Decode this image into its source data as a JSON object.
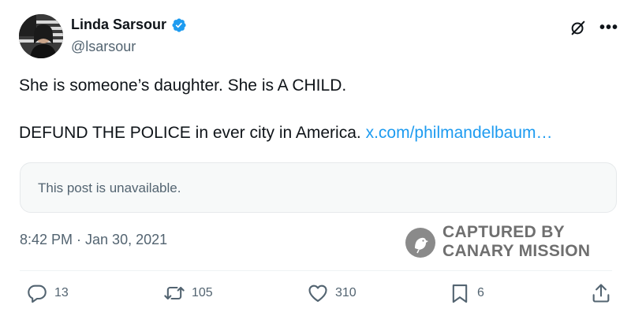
{
  "author": {
    "display_name": "Linda Sarsour",
    "handle": "@lsarsour",
    "verified": true,
    "avatar_icon": "profile-photo"
  },
  "header_actions": {
    "grok_icon": "grok-icon",
    "more_label": "•••"
  },
  "tweet": {
    "line1": "She is someone’s daughter. She is A CHILD.",
    "line2_text": "DEFUND THE POLICE in ever city in America.",
    "link_text": "x.com/philmandelbaum…"
  },
  "quoted": {
    "text": "This post is unavailable."
  },
  "timestamp": "8:42 PM · Jan 30, 2021",
  "watermark": {
    "line1": "CAPTURED BY",
    "line2": "CANARY MISSION"
  },
  "engagement": {
    "replies": "13",
    "reposts": "105",
    "likes": "310",
    "bookmarks": "6"
  },
  "colors": {
    "accent": "#1d9bf0",
    "text": "#0f1419",
    "secondary": "#536471",
    "watermark": "#6f6f6f"
  }
}
